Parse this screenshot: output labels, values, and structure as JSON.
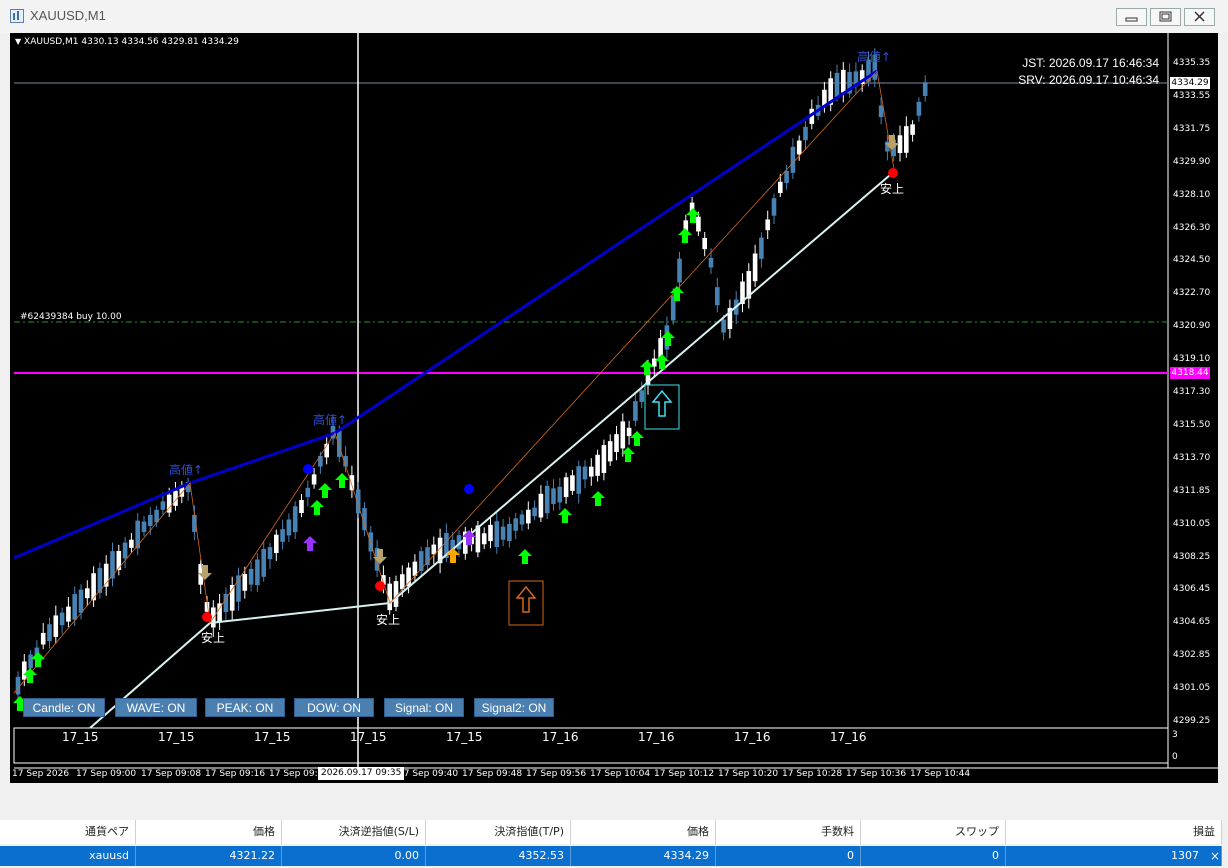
{
  "window": {
    "title": "XAUUSD,M1"
  },
  "chart": {
    "symbol_info": "XAUUSD,M1  4330.13 4334.56 4329.81 4334.29",
    "jst": "JST: 2026.09.17 16:46:34",
    "srv": "SRV: 2026.09.17 10:46:34",
    "order_line": "#62439384 buy 10.00",
    "current_price_tag": "4334.29",
    "magenta_price_tag": "4318.44",
    "price_labels": [
      "4335.35",
      "4333.55",
      "4331.75",
      "4329.90",
      "4328.10",
      "4326.30",
      "4324.50",
      "4322.70",
      "4320.90",
      "4319.10",
      "4317.30",
      "4315.50",
      "4313.70",
      "4311.85",
      "4310.05",
      "4308.25",
      "4306.45",
      "4304.65",
      "4302.85",
      "4301.05",
      "4299.25"
    ],
    "annotations": {
      "high_break_1": "高値↑",
      "high_break_2": "高値↑",
      "high_break_3": "高値↑",
      "low_up_1": "安上",
      "low_up_2": "安上",
      "low_up_3": "安上"
    },
    "sub_labels": [
      "17_15",
      "17_15",
      "17_15",
      "17_15",
      "17_15",
      "17_16",
      "17_16",
      "17_16",
      "17_16"
    ],
    "sub_scale": [
      "3",
      "0"
    ],
    "time_labels": [
      "17 Sep 2026",
      "17 Sep 09:00",
      "17 Sep 09:08",
      "17 Sep 09:16",
      "17 Sep 09:2",
      "17 Sep 09:40",
      "17 Sep 09:48",
      "17 Sep 09:56",
      "17 Sep 10:04",
      "17 Sep 10:12",
      "17 Sep 10:20",
      "17 Sep 10:28",
      "17 Sep 10:36",
      "17 Sep 10:44"
    ],
    "cursor_time": "2026.09.17 09:35",
    "buttons": [
      "Candle: ON",
      "WAVE: ON",
      "PEAK: ON",
      "DOW: ON",
      "Signal: ON",
      "Signal2: ON"
    ]
  },
  "table": {
    "headers": [
      "通貨ペア",
      "価格",
      "決済逆指値(S/L)",
      "決済指値(T/P)",
      "価格",
      "手数料",
      "スワップ",
      "損益"
    ],
    "row": [
      "xauusd",
      "4321.22",
      "0.00",
      "4352.53",
      "4334.29",
      "0",
      "0",
      "1307"
    ]
  },
  "colors": {
    "bull": "#4682b4",
    "bear": "#ffffff",
    "wave": "#0000cd",
    "support": "#b0e0e6",
    "magenta": "#ff00ff",
    "arrow": "#00ff00"
  }
}
